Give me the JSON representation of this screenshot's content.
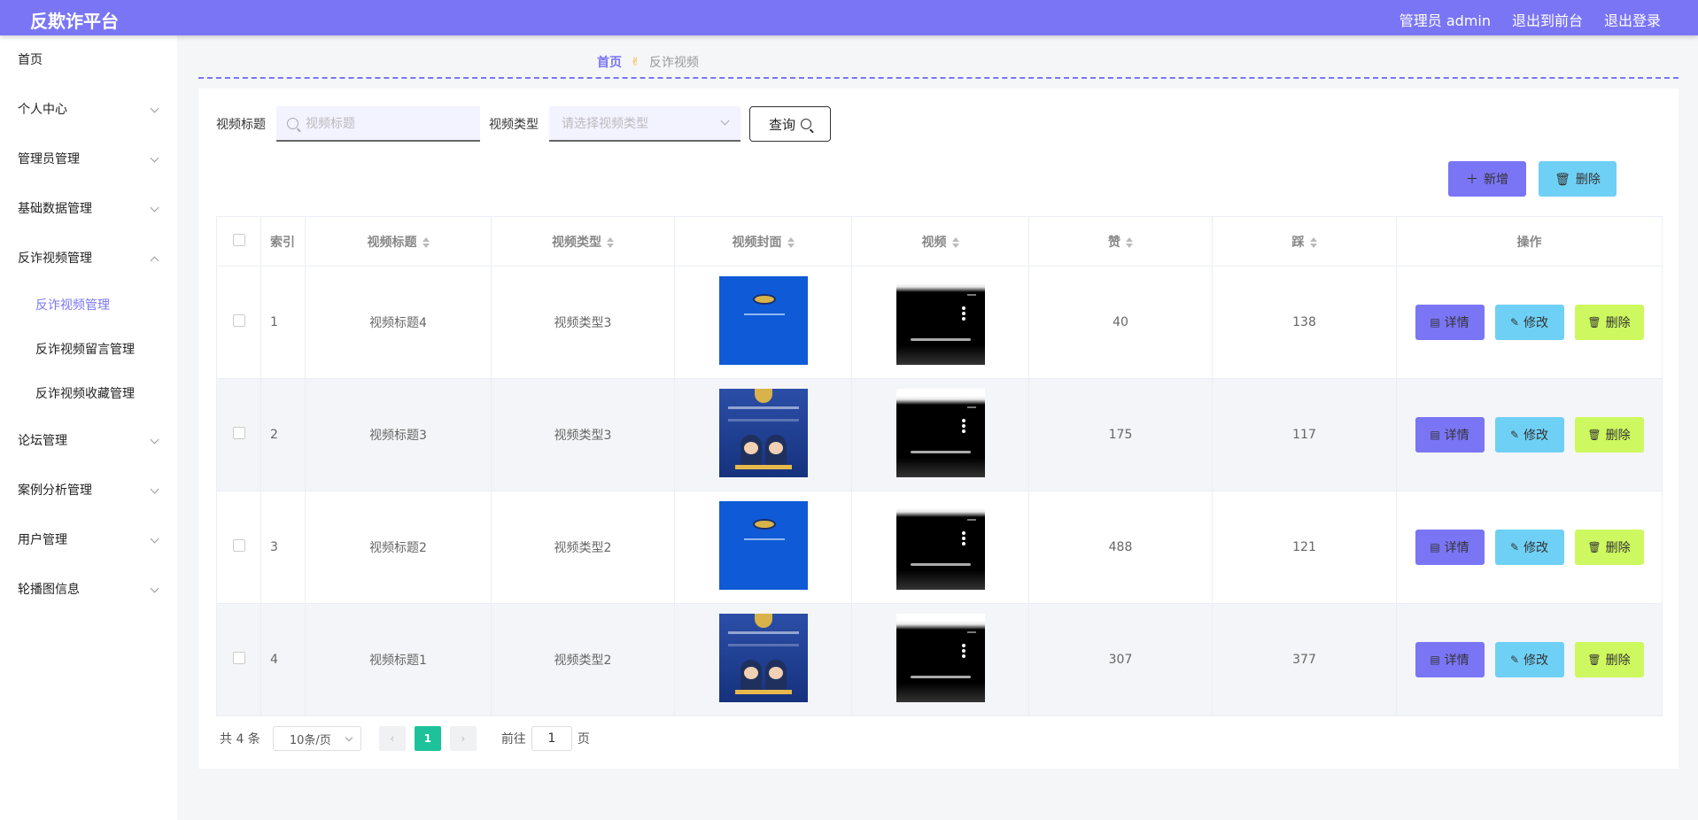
{
  "header": {
    "brand": "反欺诈平台",
    "admin_label": "管理员 admin",
    "to_front": "退出到前台",
    "logout": "退出登录"
  },
  "sidebar": {
    "items": [
      {
        "label": "首页"
      },
      {
        "label": "个人中心"
      },
      {
        "label": "管理员管理"
      },
      {
        "label": "基础数据管理"
      },
      {
        "label": "反诈视频管理"
      },
      {
        "label": "论坛管理"
      },
      {
        "label": "案例分析管理"
      },
      {
        "label": "用户管理"
      },
      {
        "label": "轮播图信息"
      }
    ],
    "subitems": [
      {
        "label": "反诈视频管理"
      },
      {
        "label": "反诈视频留言管理"
      },
      {
        "label": "反诈视频收藏管理"
      }
    ]
  },
  "breadcrumb": {
    "home": "首页",
    "sep_icon": "hand-icon",
    "current": "反诈视频"
  },
  "search": {
    "title_label": "视频标题",
    "title_placeholder": "视频标题",
    "type_label": "视频类型",
    "type_placeholder": "请选择视频类型",
    "query_label": "查询"
  },
  "actions": {
    "add_label": "新增",
    "delete_label": "删除"
  },
  "table": {
    "headers": {
      "index": "索引",
      "title": "视频标题",
      "type": "视频类型",
      "cover": "视频封面",
      "video": "视频",
      "likes": "赞",
      "dislikes": "踩",
      "ops": "操作"
    },
    "rows": [
      {
        "index": "1",
        "title": "视频标题4",
        "type": "视频类型3",
        "likes": "40",
        "dislikes": "138",
        "cover": "blue-logo"
      },
      {
        "index": "2",
        "title": "视频标题3",
        "type": "视频类型3",
        "likes": "175",
        "dislikes": "117",
        "cover": "police-cartoon"
      },
      {
        "index": "3",
        "title": "视频标题2",
        "type": "视频类型2",
        "likes": "488",
        "dislikes": "121",
        "cover": "blue-logo"
      },
      {
        "index": "4",
        "title": "视频标题1",
        "type": "视频类型2",
        "likes": "307",
        "dislikes": "377",
        "cover": "police-cartoon"
      }
    ],
    "op_labels": {
      "detail": "详情",
      "edit": "修改",
      "delete": "删除"
    }
  },
  "pager": {
    "total": "共 4 条",
    "page_size": "10条/页",
    "current_page": "1",
    "goto_prefix": "前往",
    "goto_value": "1",
    "goto_suffix": "页"
  },
  "colors": {
    "accent": "#7a75f5",
    "info": "#6fd0f5",
    "danger": "#cdf85f",
    "pager_active": "#1ec29a"
  }
}
